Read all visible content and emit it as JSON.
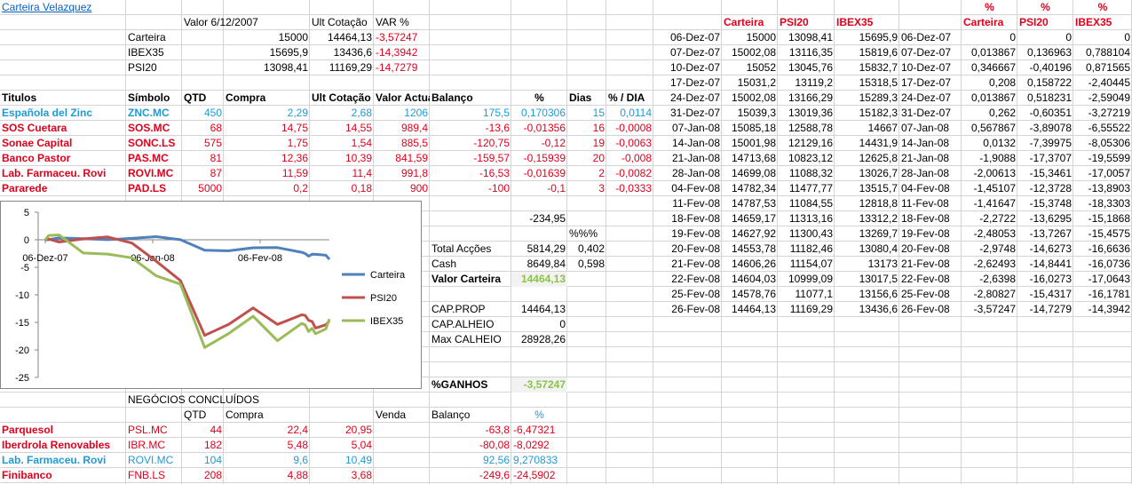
{
  "title": "Carteira Velazquez",
  "colors": {
    "red": "#e0001b",
    "blue": "#1f9ad6",
    "green": "#8bc34a",
    "carteira": "#4f81bd",
    "psi20": "#c0504d",
    "ibex35": "#9bbb59"
  },
  "summary": {
    "headers": [
      "Valor 6/12/2007",
      "Ult Cotação",
      "VAR %"
    ],
    "rows": [
      {
        "name": "Carteira",
        "v1": "15000",
        "v2": "14464,13",
        "var": "-3,57247"
      },
      {
        "name": "IBEX35",
        "v1": "15695,9",
        "v2": "13436,6",
        "var": "-14,3942"
      },
      {
        "name": "PSI20",
        "v1": "13098,41",
        "v2": "11169,29",
        "var": "-14,7279"
      }
    ]
  },
  "holdings": {
    "headers": [
      "Titulos",
      "Símbolo",
      "QTD",
      "Compra",
      "Ult Cotação",
      "Valor Actual",
      "Balanço",
      "%",
      "Dias",
      "% / DIA"
    ],
    "rows": [
      [
        "Española del Zinc",
        "ZNC.MC",
        "450",
        "2,29",
        "2,68",
        "1206",
        "175,5",
        "0,170306",
        "15",
        "0,0114"
      ],
      [
        "SOS Cuetara",
        "SOS.MC",
        "68",
        "14,75",
        "14,55",
        "989,4",
        "-13,6",
        "-0,01356",
        "16",
        "-0,0008"
      ],
      [
        "Sonae Capital",
        "SONC.LS",
        "575",
        "1,75",
        "1,54",
        "885,5",
        "-120,75",
        "-0,12",
        "19",
        "-0,0063"
      ],
      [
        "Banco Pastor",
        "PAS.MC",
        "81",
        "12,36",
        "10,39",
        "841,59",
        "-159,57",
        "-0,15939",
        "20",
        "-0,008"
      ],
      [
        "Lab. Farmaceu. Rovi",
        "ROVI.MC",
        "87",
        "11,59",
        "11,4",
        "991,8",
        "-16,53",
        "-0,01639",
        "2",
        "-0,0082"
      ],
      [
        "Pararede",
        "PAD.LS",
        "5000",
        "0,2",
        "0,18",
        "900",
        "-100",
        "-0,1",
        "3",
        "-0,0333"
      ]
    ],
    "total_balance": "-234,95"
  },
  "totals": {
    "pct_header": "%%%",
    "total_accoes_label": "Total Acções",
    "total_accoes": "5814,29",
    "total_accoes_pct": "0,402",
    "cash_label": "Cash",
    "cash": "8649,84",
    "cash_pct": "0,598",
    "valor_label": "Valor Carteira",
    "valor": "14464,13",
    "cap_prop_label": "CAP.PROP",
    "cap_prop": "14464,13",
    "cap_alheio_label": "CAP.ALHEIO",
    "cap_alheio": "0",
    "max_calheio_label": "Max CALHEIO",
    "max_calheio": "28928,26",
    "ganhos_label": "%GANHOS",
    "ganhos": "-3,57247"
  },
  "closed": {
    "title": "NEGÓCIOS CONCLUÍDOS",
    "headers": [
      "QTD",
      "Compra",
      "Venda",
      "Balanço",
      "%"
    ],
    "rows": [
      [
        "Parquesol",
        "PSL.MC",
        "44",
        "22,4",
        "20,95",
        "-63,8",
        "-6,47321"
      ],
      [
        "Iberdrola Renovables",
        "IBR.MC",
        "182",
        "5,48",
        "5,04",
        "-80,08",
        "-8,0292"
      ],
      [
        "Lab. Farmaceu. Rovi",
        "ROVI.MC",
        "104",
        "9,6",
        "10,49",
        "92,56",
        "9,270833"
      ],
      [
        "Finibanco",
        "FNB.LS",
        "208",
        "4,88",
        "3,68",
        "-249,6",
        "-24,5902"
      ]
    ]
  },
  "history": {
    "headers": [
      "Carteira",
      "PSI20",
      "IBEX35"
    ],
    "rows": [
      [
        "06-Dez-07",
        "15000",
        "13098,41",
        "15695,9"
      ],
      [
        "07-Dez-07",
        "15002,08",
        "13116,35",
        "15819,6"
      ],
      [
        "10-Dez-07",
        "15052",
        "13045,76",
        "15832,7"
      ],
      [
        "17-Dez-07",
        "15031,2",
        "13119,2",
        "15318,5"
      ],
      [
        "24-Dez-07",
        "15002,08",
        "13166,29",
        "15289,3"
      ],
      [
        "31-Dez-07",
        "15039,3",
        "13019,36",
        "15182,3"
      ],
      [
        "07-Jan-08",
        "15085,18",
        "12588,78",
        "14667"
      ],
      [
        "14-Jan-08",
        "15001,98",
        "12129,16",
        "14431,9"
      ],
      [
        "21-Jan-08",
        "14713,68",
        "10823,12",
        "12625,8"
      ],
      [
        "28-Jan-08",
        "14699,08",
        "11088,32",
        "13026,7"
      ],
      [
        "04-Fev-08",
        "14782,34",
        "11477,77",
        "13515,7"
      ],
      [
        "11-Fev-08",
        "14787,53",
        "11084,55",
        "12818,8"
      ],
      [
        "18-Fev-08",
        "14659,17",
        "11313,16",
        "13312,2"
      ],
      [
        "19-Fev-08",
        "14627,92",
        "11300,43",
        "13269,7"
      ],
      [
        "20-Fev-08",
        "14553,78",
        "11182,46",
        "13080,4"
      ],
      [
        "21-Fev-08",
        "14606,26",
        "11154,07",
        "13173"
      ],
      [
        "22-Fev-08",
        "14604,03",
        "10999,09",
        "13017,5"
      ],
      [
        "25-Fev-08",
        "14578,76",
        "11077,1",
        "13156,6"
      ],
      [
        "26-Fev-08",
        "14464,13",
        "11169,29",
        "13436,6"
      ]
    ]
  },
  "pct": {
    "top_headers": [
      "%",
      "%",
      "%"
    ],
    "headers": [
      "Carteira",
      "PSI20",
      "IBEX35"
    ],
    "rows": [
      [
        "06-Dez-07",
        "0",
        "0",
        "0"
      ],
      [
        "07-Dez-07",
        "0,013867",
        "0,136963",
        "0,788104"
      ],
      [
        "10-Dez-07",
        "0,346667",
        "-0,40196",
        "0,871565"
      ],
      [
        "17-Dez-07",
        "0,208",
        "0,158722",
        "-2,40445"
      ],
      [
        "24-Dez-07",
        "0,013867",
        "0,518231",
        "-2,59049"
      ],
      [
        "31-Dez-07",
        "0,262",
        "-0,60351",
        "-3,27219"
      ],
      [
        "07-Jan-08",
        "0,567867",
        "-3,89078",
        "-6,55522"
      ],
      [
        "14-Jan-08",
        "0,0132",
        "-7,39975",
        "-8,05306"
      ],
      [
        "21-Jan-08",
        "-1,9088",
        "-17,3707",
        "-19,5599"
      ],
      [
        "28-Jan-08",
        "-2,00613",
        "-15,3461",
        "-17,0057"
      ],
      [
        "04-Fev-08",
        "-1,45107",
        "-12,3728",
        "-13,8903"
      ],
      [
        "11-Fev-08",
        "-1,41647",
        "-15,3748",
        "-18,3303"
      ],
      [
        "18-Fev-08",
        "-2,2722",
        "-13,6295",
        "-15,1868"
      ],
      [
        "19-Fev-08",
        "-2,48053",
        "-13,7267",
        "-15,4575"
      ],
      [
        "20-Fev-08",
        "-2,9748",
        "-14,6273",
        "-16,6636"
      ],
      [
        "21-Fev-08",
        "-2,62493",
        "-14,8441",
        "-16,0736"
      ],
      [
        "22-Fev-08",
        "-2,6398",
        "-16,0273",
        "-17,0643"
      ],
      [
        "25-Fev-08",
        "-2,80827",
        "-15,4317",
        "-16,1781"
      ],
      [
        "26-Fev-08",
        "-3,57247",
        "-14,7279",
        "-14,3942"
      ]
    ]
  },
  "chart_data": {
    "type": "line",
    "x": [
      "06-Dez-07",
      "07-Dez-07",
      "10-Dez-07",
      "17-Dez-07",
      "24-Dez-07",
      "31-Dez-07",
      "07-Jan-08",
      "14-Jan-08",
      "21-Jan-08",
      "28-Jan-08",
      "04-Fev-08",
      "11-Fev-08",
      "18-Fev-08",
      "19-Fev-08",
      "20-Fev-08",
      "21-Fev-08",
      "22-Fev-08",
      "25-Fev-08",
      "26-Fev-08"
    ],
    "tick_labels": [
      "06-Dez-07",
      "06-Jan-08",
      "06-Fev-08"
    ],
    "y_ticks": [
      "5",
      "0",
      "-5",
      "-10",
      "-15",
      "-20",
      "-25"
    ],
    "ylim": [
      -25,
      5
    ],
    "grid": false,
    "legend": "right",
    "series": [
      {
        "name": "Carteira",
        "values": [
          0,
          0.013867,
          0.346667,
          0.208,
          0.013867,
          0.262,
          0.567867,
          0.0132,
          -1.9088,
          -2.00613,
          -1.45107,
          -1.41647,
          -2.2722,
          -2.48053,
          -2.9748,
          -2.62493,
          -2.6398,
          -2.80827,
          -3.57247
        ]
      },
      {
        "name": "PSI20",
        "values": [
          0,
          0.136963,
          -0.40196,
          0.158722,
          0.518231,
          -0.60351,
          -3.89078,
          -7.39975,
          -17.3707,
          -15.3461,
          -12.3728,
          -15.3748,
          -13.6295,
          -13.7267,
          -14.6273,
          -14.8441,
          -16.0273,
          -15.4317,
          -14.7279
        ]
      },
      {
        "name": "IBEX35",
        "values": [
          0,
          0.788104,
          0.871565,
          -2.40445,
          -2.59049,
          -3.27219,
          -6.55522,
          -8.05306,
          -19.5599,
          -17.0057,
          -13.8903,
          -18.3303,
          -15.1868,
          -15.4575,
          -16.6636,
          -16.0736,
          -17.0643,
          -16.1781,
          -14.3942
        ]
      }
    ]
  }
}
